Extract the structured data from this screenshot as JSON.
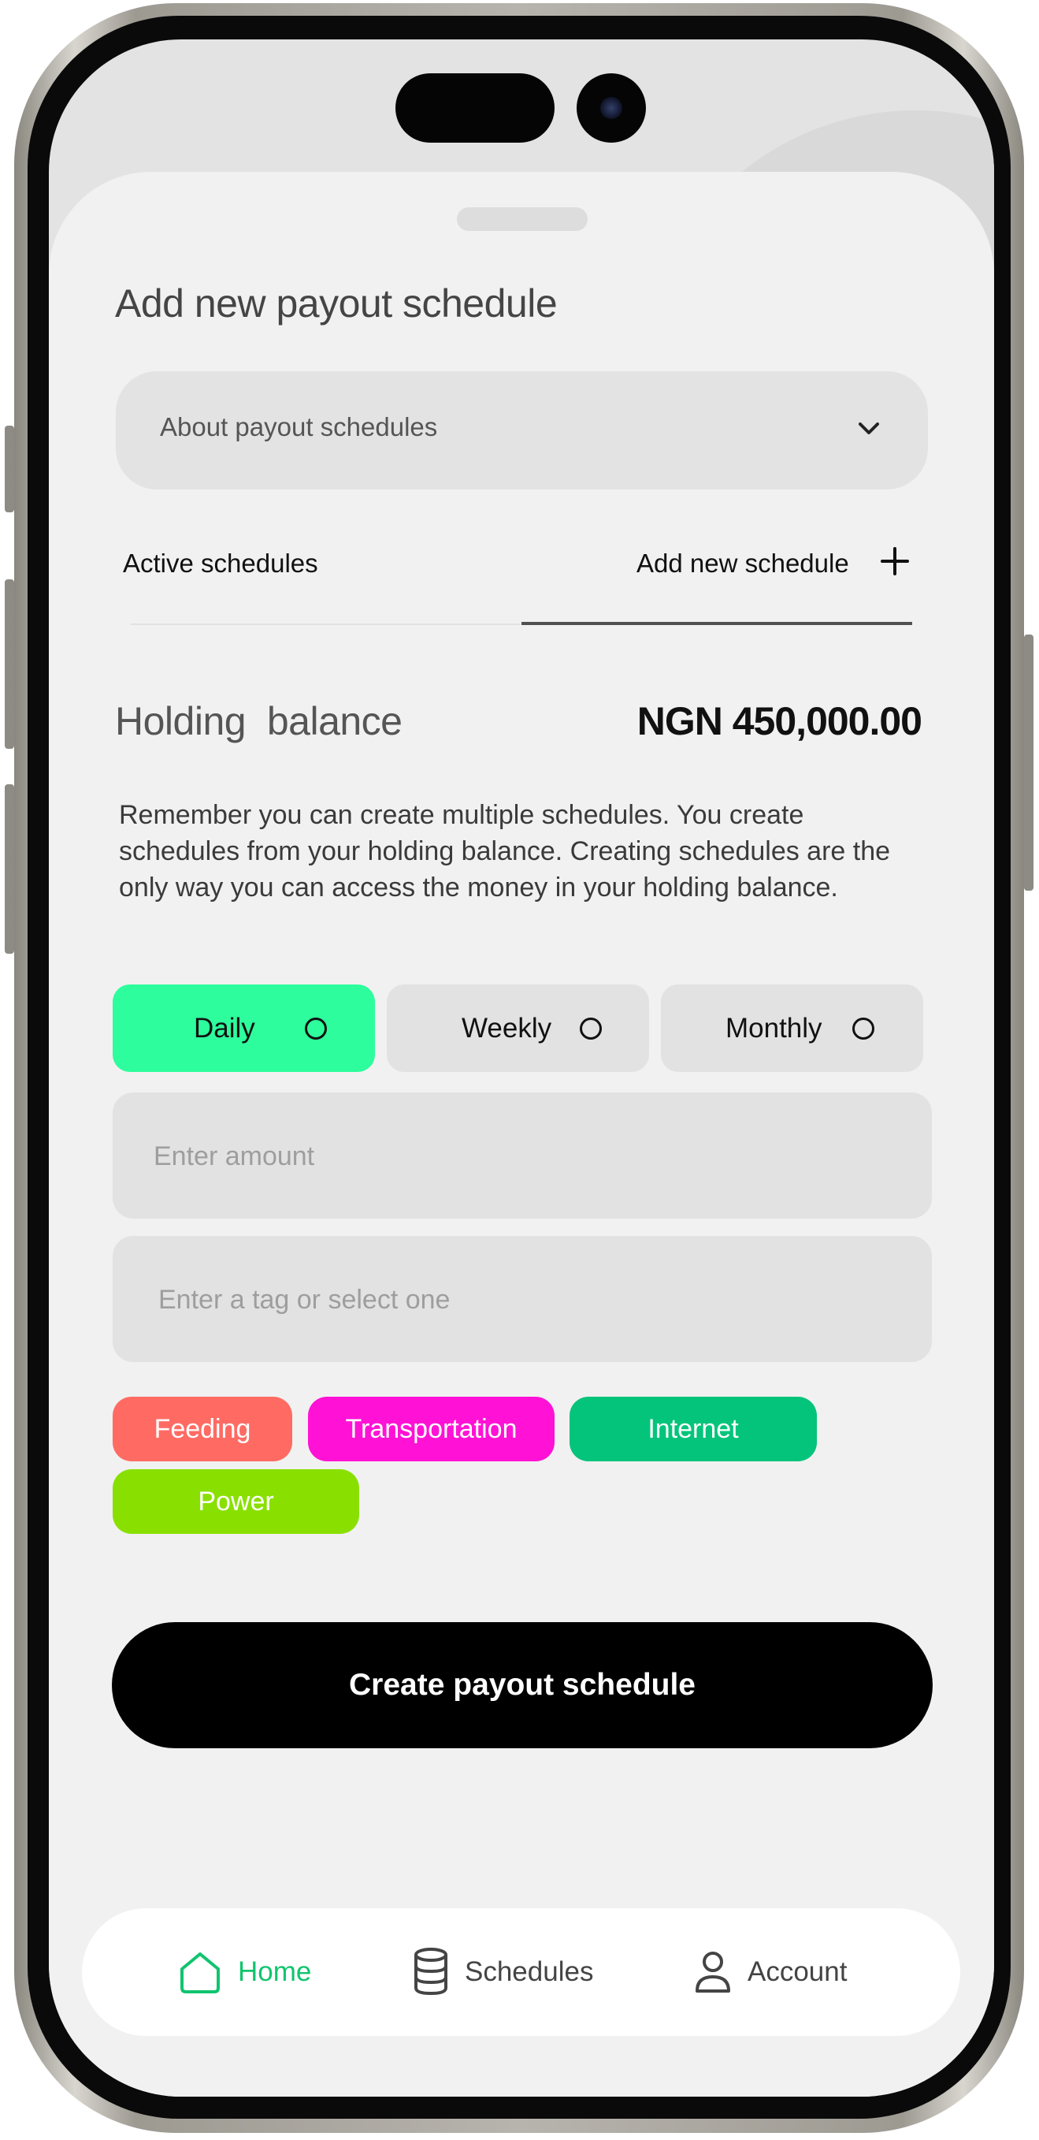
{
  "sheet": {
    "title": "Add new payout schedule"
  },
  "accordion": {
    "label": "About payout schedules",
    "icon": "chevron-down-icon"
  },
  "tabs": [
    {
      "label": "Active schedules",
      "active": false
    },
    {
      "label": "Add new schedule",
      "active": true,
      "icon": "plus-icon"
    }
  ],
  "holding": {
    "label": "Holding  balance",
    "value": "NGN 450,000.00"
  },
  "note": "Remember you can create multiple schedules. You create schedules from your holding balance. Creating schedules are the only way you can access the money in your holding balance.",
  "frequency": {
    "options": [
      {
        "label": "Daily",
        "selected": true
      },
      {
        "label": "Weekly",
        "selected": false
      },
      {
        "label": "Monthly",
        "selected": false
      }
    ],
    "selected_color": "#2dfd9c"
  },
  "amount_input": {
    "placeholder": "Enter amount",
    "value": ""
  },
  "tag_input": {
    "placeholder": "Enter a tag or select one",
    "value": ""
  },
  "tags": [
    {
      "label": "Feeding",
      "color": "#ff6b63"
    },
    {
      "label": "Transportation",
      "color": "#ff12d5"
    },
    {
      "label": "Internet",
      "color": "#04c47b"
    },
    {
      "label": "Power",
      "color": "#89e000"
    }
  ],
  "cta": {
    "label": "Create payout schedule"
  },
  "bottom_nav": [
    {
      "label": "Home",
      "icon": "home-icon",
      "active": true
    },
    {
      "label": "Schedules",
      "icon": "coins-stack-icon",
      "active": false
    },
    {
      "label": "Account",
      "icon": "user-icon",
      "active": false
    }
  ],
  "colors": {
    "accent_green": "#10c46e",
    "background": "#f1f1f1",
    "field": "#e2e2e2"
  }
}
